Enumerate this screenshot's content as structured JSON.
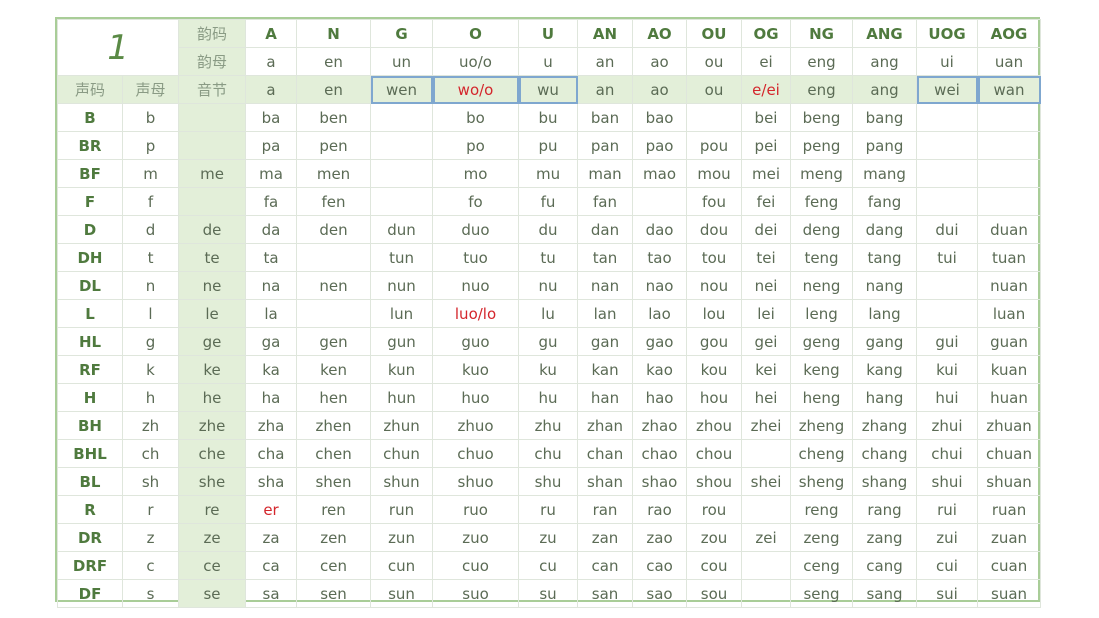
{
  "title": "1",
  "labels": {
    "yunma": "韵码",
    "yunmu": "韵母",
    "yinjie": "音节",
    "shengma": "声码",
    "shengmu": "声母"
  },
  "columns": [
    {
      "code": "A",
      "final": "a",
      "syllable": "a",
      "syllable_red": false,
      "selected": false
    },
    {
      "code": "N",
      "final": "en",
      "syllable": "en",
      "syllable_red": false,
      "selected": false
    },
    {
      "code": "G",
      "final": "un",
      "syllable": "wen",
      "syllable_red": false,
      "selected": true
    },
    {
      "code": "O",
      "final": "uo/o",
      "syllable": "wo/o",
      "syllable_red": true,
      "selected": true
    },
    {
      "code": "U",
      "final": "u",
      "syllable": "wu",
      "syllable_red": false,
      "selected": true
    },
    {
      "code": "AN",
      "final": "an",
      "syllable": "an",
      "syllable_red": false,
      "selected": false
    },
    {
      "code": "AO",
      "final": "ao",
      "syllable": "ao",
      "syllable_red": false,
      "selected": false
    },
    {
      "code": "OU",
      "final": "ou",
      "syllable": "ou",
      "syllable_red": false,
      "selected": false
    },
    {
      "code": "OG",
      "final": "ei",
      "syllable": "e/ei",
      "syllable_red": true,
      "selected": false
    },
    {
      "code": "NG",
      "final": "eng",
      "syllable": "eng",
      "syllable_red": false,
      "selected": false
    },
    {
      "code": "ANG",
      "final": "ang",
      "syllable": "ang",
      "syllable_red": false,
      "selected": false
    },
    {
      "code": "UOG",
      "final": "ui",
      "syllable": "wei",
      "syllable_red": false,
      "selected": true
    },
    {
      "code": "AOG",
      "final": "uan",
      "syllable": "wan",
      "syllable_red": false,
      "selected": true
    }
  ],
  "rows": [
    {
      "code": "B",
      "initial": "b",
      "syllable": "",
      "cells": [
        "ba",
        "ben",
        "",
        "bo",
        "bu",
        "ban",
        "bao",
        "",
        "bei",
        "beng",
        "bang",
        "",
        ""
      ]
    },
    {
      "code": "BR",
      "initial": "p",
      "syllable": "",
      "cells": [
        "pa",
        "pen",
        "",
        "po",
        "pu",
        "pan",
        "pao",
        "pou",
        "pei",
        "peng",
        "pang",
        "",
        ""
      ]
    },
    {
      "code": "BF",
      "initial": "m",
      "syllable": "me",
      "cells": [
        "ma",
        "men",
        "",
        "mo",
        "mu",
        "man",
        "mao",
        "mou",
        "mei",
        "meng",
        "mang",
        "",
        ""
      ]
    },
    {
      "code": "F",
      "initial": "f",
      "syllable": "",
      "cells": [
        "fa",
        "fen",
        "",
        "fo",
        "fu",
        "fan",
        "",
        "fou",
        "fei",
        "feng",
        "fang",
        "",
        ""
      ]
    },
    {
      "code": "D",
      "initial": "d",
      "syllable": "de",
      "cells": [
        "da",
        "den",
        "dun",
        "duo",
        "du",
        "dan",
        "dao",
        "dou",
        "dei",
        "deng",
        "dang",
        "dui",
        "duan"
      ]
    },
    {
      "code": "DH",
      "initial": "t",
      "syllable": "te",
      "cells": [
        "ta",
        "",
        "tun",
        "tuo",
        "tu",
        "tan",
        "tao",
        "tou",
        "tei",
        "teng",
        "tang",
        "tui",
        "tuan"
      ]
    },
    {
      "code": "DL",
      "initial": "n",
      "syllable": "ne",
      "cells": [
        "na",
        "nen",
        "nun",
        "nuo",
        "nu",
        "nan",
        "nao",
        "nou",
        "nei",
        "neng",
        "nang",
        "",
        "nuan"
      ]
    },
    {
      "code": "L",
      "initial": "l",
      "syllable": "le",
      "cells": [
        "la",
        "",
        "lun",
        "luo/lo",
        "lu",
        "lan",
        "lao",
        "lou",
        "lei",
        "leng",
        "lang",
        "",
        "luan"
      ],
      "red_cells": [
        3
      ]
    },
    {
      "code": "HL",
      "initial": "g",
      "syllable": "ge",
      "cells": [
        "ga",
        "gen",
        "gun",
        "guo",
        "gu",
        "gan",
        "gao",
        "gou",
        "gei",
        "geng",
        "gang",
        "gui",
        "guan"
      ]
    },
    {
      "code": "RF",
      "initial": "k",
      "syllable": "ke",
      "cells": [
        "ka",
        "ken",
        "kun",
        "kuo",
        "ku",
        "kan",
        "kao",
        "kou",
        "kei",
        "keng",
        "kang",
        "kui",
        "kuan"
      ]
    },
    {
      "code": "H",
      "initial": "h",
      "syllable": "he",
      "cells": [
        "ha",
        "hen",
        "hun",
        "huo",
        "hu",
        "han",
        "hao",
        "hou",
        "hei",
        "heng",
        "hang",
        "hui",
        "huan"
      ]
    },
    {
      "code": "BH",
      "initial": "zh",
      "syllable": "zhe",
      "cells": [
        "zha",
        "zhen",
        "zhun",
        "zhuo",
        "zhu",
        "zhan",
        "zhao",
        "zhou",
        "zhei",
        "zheng",
        "zhang",
        "zhui",
        "zhuan"
      ]
    },
    {
      "code": "BHL",
      "initial": "ch",
      "syllable": "che",
      "cells": [
        "cha",
        "chen",
        "chun",
        "chuo",
        "chu",
        "chan",
        "chao",
        "chou",
        "",
        "cheng",
        "chang",
        "chui",
        "chuan"
      ]
    },
    {
      "code": "BL",
      "initial": "sh",
      "syllable": "she",
      "cells": [
        "sha",
        "shen",
        "shun",
        "shuo",
        "shu",
        "shan",
        "shao",
        "shou",
        "shei",
        "sheng",
        "shang",
        "shui",
        "shuan"
      ]
    },
    {
      "code": "R",
      "initial": "r",
      "syllable": "re",
      "cells": [
        "er",
        "ren",
        "run",
        "ruo",
        "ru",
        "ran",
        "rao",
        "rou",
        "",
        "reng",
        "rang",
        "rui",
        "ruan"
      ],
      "red_cells": [
        0
      ]
    },
    {
      "code": "DR",
      "initial": "z",
      "syllable": "ze",
      "cells": [
        "za",
        "zen",
        "zun",
        "zuo",
        "zu",
        "zan",
        "zao",
        "zou",
        "zei",
        "zeng",
        "zang",
        "zui",
        "zuan"
      ]
    },
    {
      "code": "DRF",
      "initial": "c",
      "syllable": "ce",
      "cells": [
        "ca",
        "cen",
        "cun",
        "cuo",
        "cu",
        "can",
        "cao",
        "cou",
        "",
        "ceng",
        "cang",
        "cui",
        "cuan"
      ]
    },
    {
      "code": "DF",
      "initial": "s",
      "syllable": "se",
      "cells": [
        "sa",
        "sen",
        "sun",
        "suo",
        "su",
        "san",
        "sao",
        "sou",
        "",
        "seng",
        "sang",
        "sui",
        "suan"
      ]
    }
  ],
  "colors": {
    "accent_green": "#4f7a3e",
    "highlight_bg": "#e3efd9",
    "red_text": "#d4262c",
    "selection_border": "#7fa7cf",
    "outer_border": "#a9cd98"
  }
}
